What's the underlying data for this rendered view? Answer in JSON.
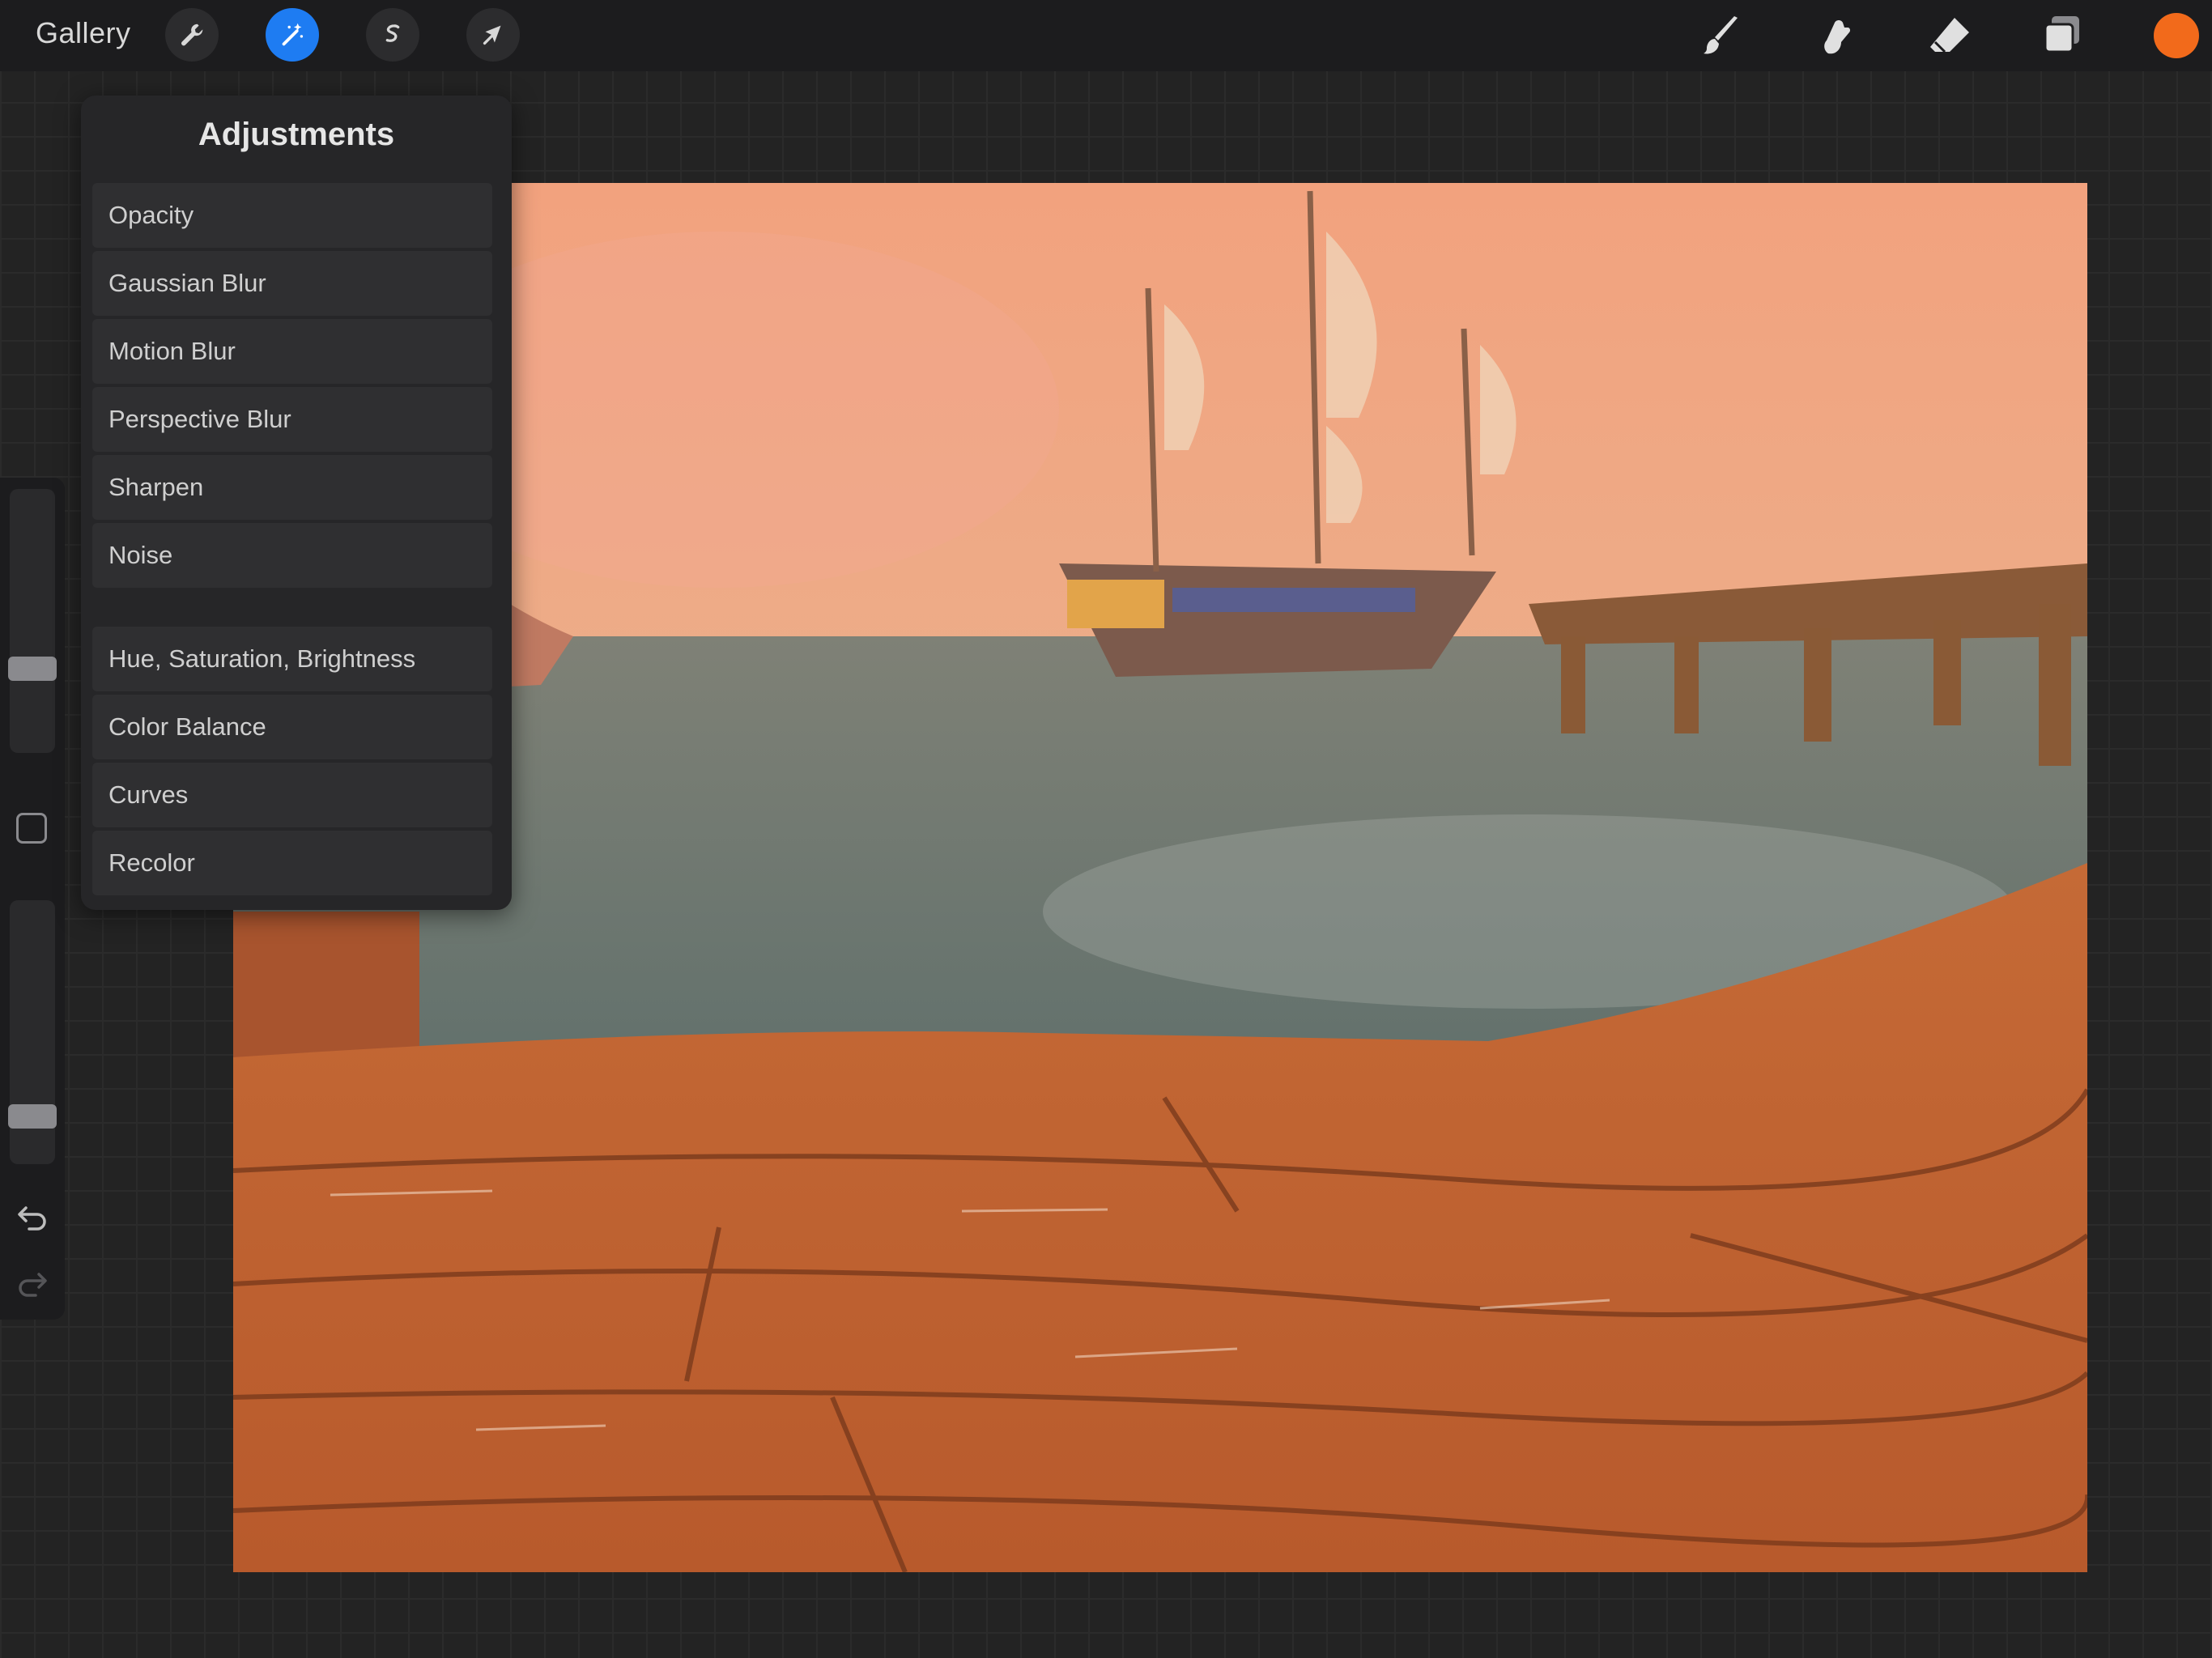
{
  "toolbar": {
    "gallery_label": "Gallery",
    "left_tools": [
      {
        "name": "actions",
        "icon": "wrench-icon",
        "active": false
      },
      {
        "name": "adjustments",
        "icon": "magic-wand-icon",
        "active": true
      },
      {
        "name": "selection",
        "icon": "selection-s-icon",
        "active": false
      },
      {
        "name": "transform",
        "icon": "arrow-cursor-icon",
        "active": false
      }
    ],
    "right_tools": [
      "brush-icon",
      "smudge-icon",
      "eraser-icon",
      "layers-icon"
    ],
    "current_color": "#f26a1b",
    "active_accent": "#1e7cf2"
  },
  "adjustments": {
    "title": "Adjustments",
    "items": [
      "Opacity",
      "Gaussian Blur",
      "Motion Blur",
      "Perspective Blur",
      "Sharpen",
      "Noise",
      "Hue, Saturation, Brightness",
      "Color Balance",
      "Curves",
      "Recolor"
    ]
  },
  "sidebar": {
    "brush_size_level": 0.3,
    "brush_opacity_level": 0.15,
    "icons": [
      "modify-square-icon",
      "undo-icon",
      "redo-icon"
    ]
  }
}
